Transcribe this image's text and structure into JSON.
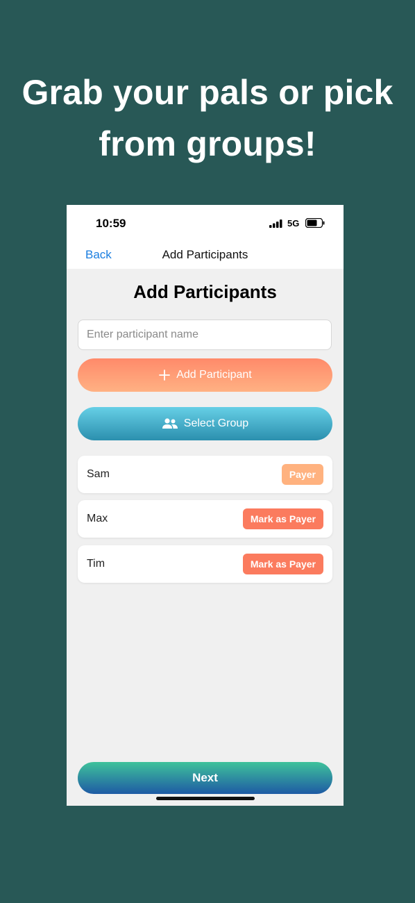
{
  "headline": {
    "line1": "Grab your pals or pick",
    "line2": "from groups!"
  },
  "status": {
    "time": "10:59",
    "network": "5G"
  },
  "nav": {
    "back": "Back",
    "title": "Add Participants"
  },
  "page": {
    "title": "Add Participants"
  },
  "input": {
    "placeholder": "Enter participant name",
    "value": ""
  },
  "buttons": {
    "add": "Add Participant",
    "group": "Select Group",
    "next": "Next"
  },
  "participants": [
    {
      "name": "Sam",
      "action": "Payer",
      "is_payer": true
    },
    {
      "name": "Max",
      "action": "Mark as Payer",
      "is_payer": false
    },
    {
      "name": "Tim",
      "action": "Mark as Payer",
      "is_payer": false
    }
  ],
  "colors": {
    "background": "#285856",
    "payer_tag": "#ffb27f",
    "mark_tag": "#fb7b5e",
    "link": "#1a7ee0"
  },
  "icons": {
    "add": "plus-icon",
    "group": "people-icon"
  }
}
